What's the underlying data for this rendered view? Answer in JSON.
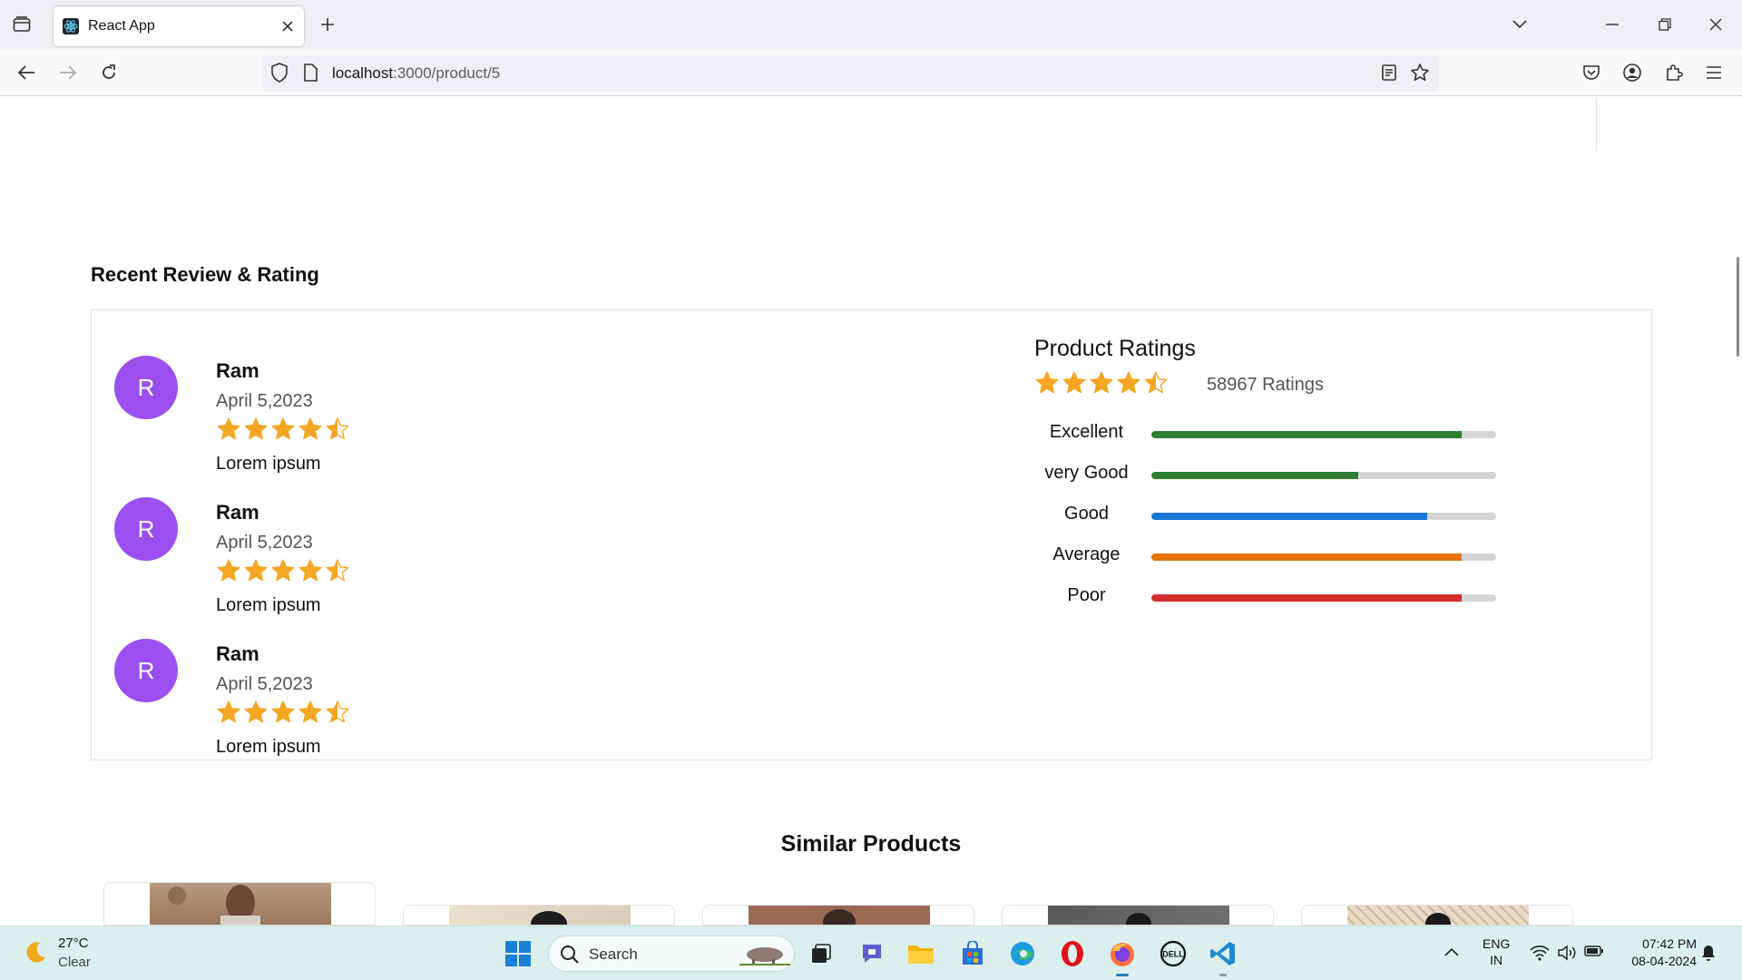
{
  "browser": {
    "tab_title": "React App",
    "url_host": "localhost",
    "url_path": ":3000/product/5"
  },
  "reviews_section": {
    "title": "Recent Review & Rating",
    "reviews": [
      {
        "initial": "R",
        "name": "Ram",
        "date": "April 5,2023",
        "rating": 4.5,
        "text": "Lorem ipsum"
      },
      {
        "initial": "R",
        "name": "Ram",
        "date": "April 5,2023",
        "rating": 4.5,
        "text": "Lorem ipsum"
      },
      {
        "initial": "R",
        "name": "Ram",
        "date": "April 5,2023",
        "rating": 4.5,
        "text": "Lorem ipsum"
      }
    ]
  },
  "product_ratings": {
    "title": "Product Ratings",
    "rating": 4.5,
    "count_label": "58967 Ratings",
    "breakdown": [
      {
        "label": "Excellent",
        "fraction": 0.9,
        "color": "#2e7d32"
      },
      {
        "label": "very Good",
        "fraction": 0.6,
        "color": "#2e7d32"
      },
      {
        "label": "Good",
        "fraction": 0.8,
        "color": "#1976d2"
      },
      {
        "label": "Average",
        "fraction": 0.9,
        "color": "#e8710a"
      },
      {
        "label": "Poor",
        "fraction": 0.9,
        "color": "#d32f2f"
      }
    ]
  },
  "similar_products": {
    "title": "Similar Products"
  },
  "taskbar": {
    "temperature": "27°C",
    "condition": "Clear",
    "search_placeholder": "Search",
    "language_top": "ENG",
    "language_bottom": "IN",
    "time": "07:42 PM",
    "date": "08-04-2024"
  },
  "colors": {
    "avatar": "#9b4ff0",
    "star": "#f5a623",
    "star_empty": "#cfcfcf"
  }
}
